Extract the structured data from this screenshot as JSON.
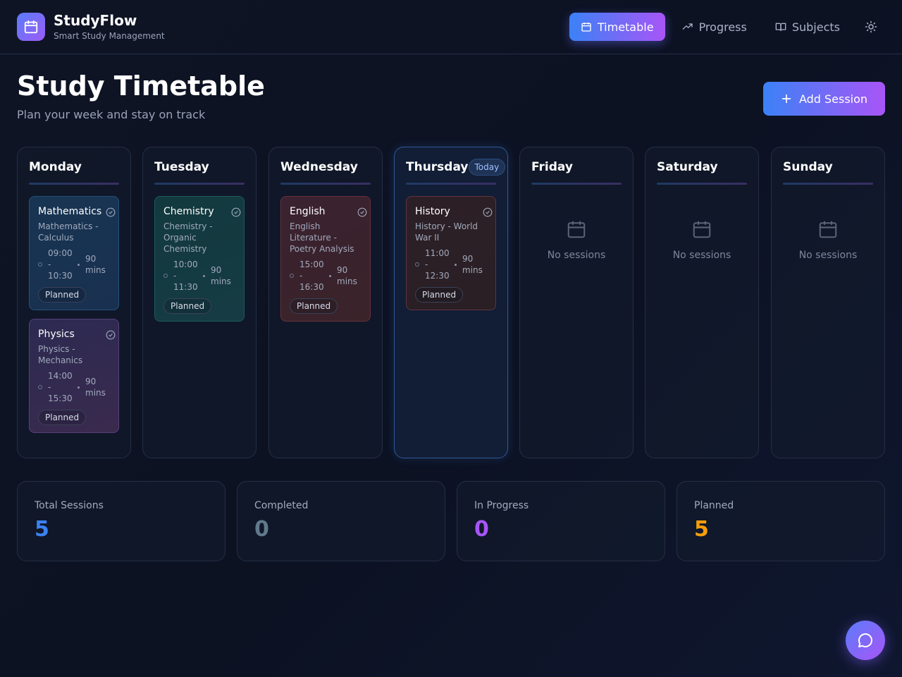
{
  "app": {
    "name": "StudyFlow",
    "tagline": "Smart Study Management"
  },
  "nav": {
    "timetable": "Timetable",
    "progress": "Progress",
    "subjects": "Subjects"
  },
  "page": {
    "title": "Study Timetable",
    "subtitle": "Plan your week and stay on track",
    "add_button": "Add Session"
  },
  "today_badge": "Today",
  "empty_label": "No sessions",
  "days": [
    {
      "name": "Monday",
      "sessions": [
        {
          "title": "Mathematics",
          "desc": "Mathematics - Calculus",
          "time": "09:00 - 10:30",
          "duration": "90 mins",
          "status": "Planned"
        },
        {
          "title": "Physics",
          "desc": "Physics - Mechanics",
          "time": "14:00 - 15:30",
          "duration": "90 mins",
          "status": "Planned"
        }
      ]
    },
    {
      "name": "Tuesday",
      "sessions": [
        {
          "title": "Chemistry",
          "desc": "Chemistry - Organic Chemistry",
          "time": "10:00 - 11:30",
          "duration": "90 mins",
          "status": "Planned"
        }
      ]
    },
    {
      "name": "Wednesday",
      "sessions": [
        {
          "title": "English",
          "desc": "English Literature - Poetry Analysis",
          "time": "15:00 - 16:30",
          "duration": "90 mins",
          "status": "Planned"
        }
      ]
    },
    {
      "name": "Thursday",
      "sessions": [
        {
          "title": "History",
          "desc": "History - World War II",
          "time": "11:00 - 12:30",
          "duration": "90 mins",
          "status": "Planned"
        }
      ]
    },
    {
      "name": "Friday",
      "sessions": []
    },
    {
      "name": "Saturday",
      "sessions": []
    },
    {
      "name": "Sunday",
      "sessions": []
    }
  ],
  "stats": [
    {
      "label": "Total Sessions",
      "value": "5",
      "color": "#3b82f6"
    },
    {
      "label": "Completed",
      "value": "0",
      "color": "#5f7a8c"
    },
    {
      "label": "In Progress",
      "value": "0",
      "color": "#a855f7"
    },
    {
      "label": "Planned",
      "value": "5",
      "color": "#f59e0b"
    }
  ],
  "colors": {
    "accent_start": "#3b82f6",
    "accent_end": "#a855f7"
  }
}
